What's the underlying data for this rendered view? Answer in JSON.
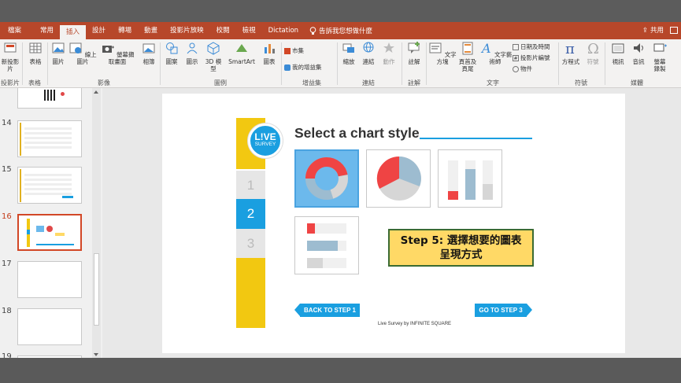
{
  "ribbon_tabs": [
    "檔案",
    "常用",
    "插入",
    "設計",
    "轉場",
    "動畫",
    "投影片放映",
    "校閱",
    "檢視",
    "Dictation"
  ],
  "active_tab": "插入",
  "tell_me": "告訴我您想做什麼",
  "share": "共用",
  "ribbon": {
    "buttons": {
      "new_slide": "新投影\n片",
      "table": "表格",
      "picture": "圖片",
      "online_picture": "線上圖片",
      "screenshot": "螢幕擷取畫面",
      "album": "相簿",
      "shapes": "圖案",
      "icons": "圖示",
      "model3d": "3D 模\n型",
      "smartart": "SmartArt",
      "chart": "圖表",
      "store": "市集",
      "my_addins": "我的增益集",
      "zoom": "縮放",
      "link": "連結",
      "action": "動作",
      "comment": "註解",
      "textbox": "文字方塊",
      "header_footer": "頁首及\n頁尾",
      "wordart": "文字藝術師",
      "date_time": "日期及時間",
      "slide_number": "投影片編號",
      "object": "物件",
      "equation": "方程式",
      "symbol": "符號",
      "video": "視訊",
      "audio": "音訊",
      "screen_recording": "螢幕\n錄製"
    },
    "groups": [
      "投影片",
      "表格",
      "影像",
      "圖例",
      "增益集",
      "連結",
      "註解",
      "文字",
      "符號",
      "媒體"
    ]
  },
  "thumbnails": {
    "numbers": [
      "14",
      "15",
      "16",
      "17",
      "18",
      "19"
    ],
    "current": "16"
  },
  "slide": {
    "title": "Select a chart style",
    "logo_line1": "L!VE",
    "logo_line2": "SURVEY",
    "steps": [
      "1",
      "2",
      "3"
    ],
    "active_step": "2",
    "callout_line1": "Step 5: 選擇想要的圖表",
    "callout_line2": "呈現方式",
    "back_button": "BACK TO STEP 1",
    "next_button": "GO TO STEP 3",
    "footer": "Live Survey by INFINITE SQUARE",
    "chart_options": [
      "donut",
      "pie",
      "column",
      "bar"
    ],
    "selected_option": "donut"
  },
  "colors": {
    "ribbon": "#b7472a",
    "accent_blue": "#1a9fe0",
    "accent_yellow": "#f2c811",
    "chart_red": "#ef4444",
    "chart_blue_grey": "#9dbcd0",
    "callout_fill": "#ffd966",
    "callout_border": "#3b6b33"
  }
}
